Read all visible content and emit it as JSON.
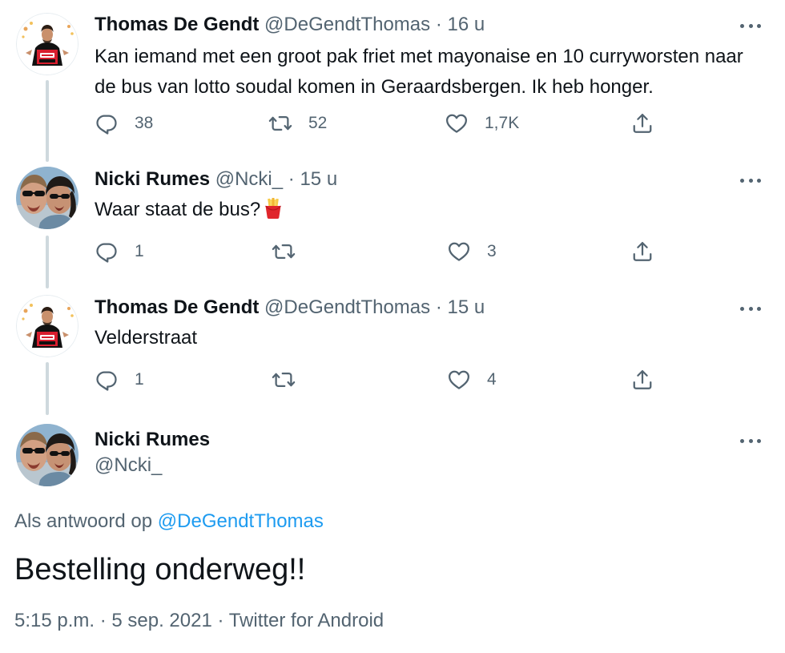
{
  "tweets": [
    {
      "name": "Thomas De Gendt",
      "handle": "@DeGendtThomas",
      "separator": "·",
      "time": "16 u",
      "text_line1": "Kan iemand met een groot pak friet met mayonaise en 10 curryworsten naar",
      "text_line2": "de bus van lotto soudal komen in Geraardsbergen. Ik heb honger.",
      "replies": "38",
      "retweets": "52",
      "likes": "1,7K"
    },
    {
      "name": "Nicki Rumes",
      "handle": "@Ncki_",
      "separator": "·",
      "time": "15 u",
      "text": "Waar staat de bus?",
      "emoji": "fries-emoji",
      "replies": "1",
      "retweets": "",
      "likes": "3"
    },
    {
      "name": "Thomas De Gendt",
      "handle": "@DeGendtThomas",
      "separator": "·",
      "time": "15 u",
      "text": "Velderstraat",
      "replies": "1",
      "retweets": "",
      "likes": "4"
    }
  ],
  "main_tweet": {
    "name": "Nicki Rumes",
    "handle": "@Ncki_",
    "reply_prefix": "Als antwoord op",
    "reply_to": "@DeGendtThomas",
    "text": "Bestelling onderweg!!",
    "timestamp": "5:15 p.m. · 5 sep. 2021 · Twitter for Android"
  },
  "icons": {
    "reply": "reply-icon",
    "retweet": "retweet-icon",
    "like": "heart-icon",
    "share": "share-icon",
    "more": "more-icon"
  },
  "colors": {
    "text": "#0f1419",
    "secondary": "#536471",
    "link": "#1d9bf0",
    "thread_line": "#cfd9de"
  }
}
